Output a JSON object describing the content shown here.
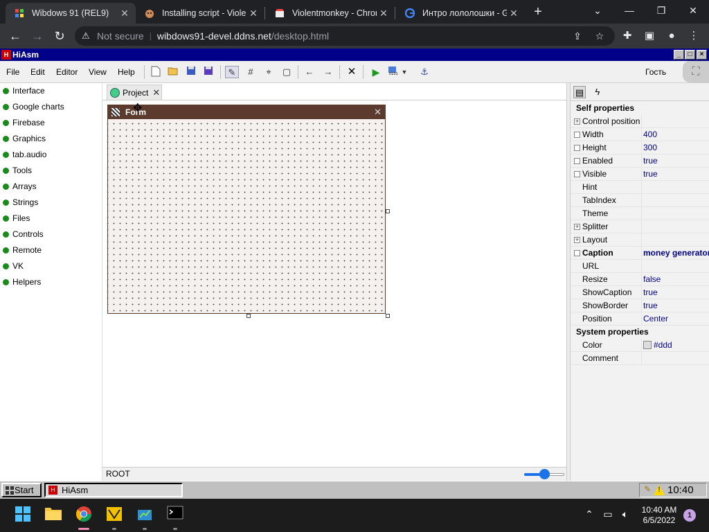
{
  "browser": {
    "tabs": [
      {
        "title": "Wibdows 91 (REL9)",
        "icon": "wibdows-favicon"
      },
      {
        "title": "Installing script - Violen",
        "icon": "violentmonkey-favicon"
      },
      {
        "title": "Violentmonkey - Chron",
        "icon": "chrome-webstore-favicon"
      },
      {
        "title": "Интро лололошки - G",
        "icon": "google-favicon"
      }
    ],
    "security_label": "Not secure",
    "url_host": "wibdows91-devel.ddns.net",
    "url_path": "/desktop.html"
  },
  "app": {
    "title": "HiAsm",
    "menu": [
      "File",
      "Edit",
      "Editor",
      "View",
      "Help"
    ],
    "user": "Гость"
  },
  "palette": [
    "Interface",
    "Google charts",
    "Firebase",
    "Graphics",
    "tab.audio",
    "Tools",
    "Arrays",
    "Strings",
    "Files",
    "Controls",
    "Remote",
    "VK",
    "Helpers"
  ],
  "project_tab": "Project",
  "form_title": "Form",
  "status": {
    "path": "ROOT",
    "zoom_fraction": 0.5
  },
  "props": {
    "self_header": "Self properties",
    "rows": [
      {
        "name": "Control position",
        "value": "",
        "marker": "+"
      },
      {
        "name": "Width",
        "value": "400",
        "marker": ""
      },
      {
        "name": "Height",
        "value": "300",
        "marker": ""
      },
      {
        "name": "Enabled",
        "value": "true",
        "marker": ""
      },
      {
        "name": "Visible",
        "value": "true",
        "marker": ""
      },
      {
        "name": "Hint",
        "value": "",
        "marker": "none"
      },
      {
        "name": "TabIndex",
        "value": "",
        "marker": "none"
      },
      {
        "name": "Theme",
        "value": "",
        "marker": "none"
      },
      {
        "name": "Splitter",
        "value": "",
        "marker": "+"
      },
      {
        "name": "Layout",
        "value": "",
        "marker": "+"
      },
      {
        "name": "Caption",
        "value": "money generator",
        "marker": ""
      },
      {
        "name": "URL",
        "value": "",
        "marker": "none"
      },
      {
        "name": "Resize",
        "value": "false",
        "marker": "none"
      },
      {
        "name": "ShowCaption",
        "value": "true",
        "marker": "none"
      },
      {
        "name": "ShowBorder",
        "value": "true",
        "marker": "none"
      },
      {
        "name": "Position",
        "value": "Center",
        "marker": "none"
      }
    ],
    "system_header": "System properties",
    "system_rows": [
      {
        "name": "Color",
        "value": "#ddd"
      },
      {
        "name": "Comment",
        "value": ""
      }
    ]
  },
  "w91_taskbar": {
    "start": "Start",
    "task": "HiAsm",
    "time": "10:40"
  },
  "win_taskbar": {
    "time": "10:40 AM",
    "date": "6/5/2022",
    "notifications": "1"
  },
  "colors": {
    "hiasm_titlebar": "#000088",
    "form_titlebar": "#5c3a2e",
    "palette_dot": "#1a8a1a",
    "accent": "#1a73e8"
  }
}
